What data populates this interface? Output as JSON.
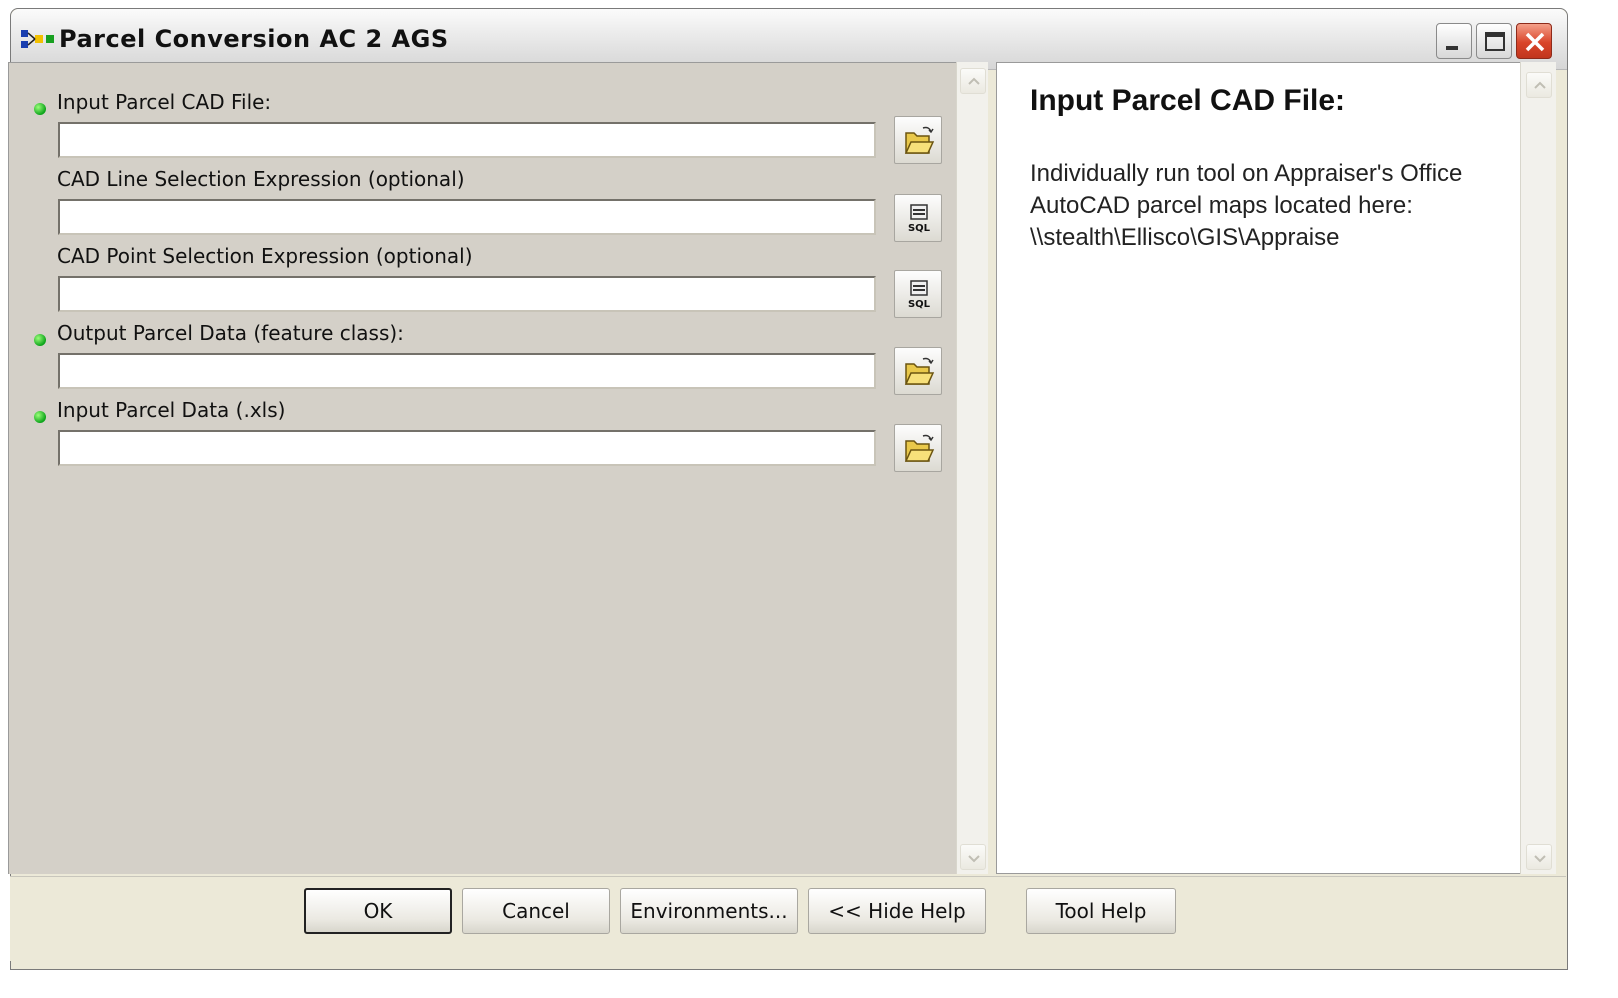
{
  "window": {
    "title": "Parcel Conversion AC 2 AGS"
  },
  "params": [
    {
      "label": "Input Parcel CAD File:",
      "required": true,
      "value": "",
      "button": "folder-icon"
    },
    {
      "label": "CAD Line Selection Expression (optional)",
      "required": false,
      "value": "",
      "button": "sql-icon"
    },
    {
      "label": "CAD Point Selection Expression (optional)",
      "required": false,
      "value": "",
      "button": "sql-icon"
    },
    {
      "label": "Output Parcel Data (feature class):",
      "required": true,
      "value": "",
      "button": "folder-icon"
    },
    {
      "label": "Input Parcel Data (.xls)",
      "required": true,
      "value": "",
      "button": "folder-icon"
    }
  ],
  "help": {
    "title": "Input Parcel CAD File:",
    "lines": [
      "Individually run tool on Appraiser's Office",
      "AutoCAD parcel maps located here:",
      "\\\\stealth\\Ellisco\\GIS\\Appraise"
    ]
  },
  "buttons": {
    "ok": "OK",
    "cancel": "Cancel",
    "environments": "Environments...",
    "hide_help": "<< Hide Help",
    "tool_help": "Tool Help"
  },
  "colors": {
    "required_bullet": "#0ca31a",
    "panel_bg": "#d4d0c8",
    "window_bg": "#ece9d8"
  }
}
